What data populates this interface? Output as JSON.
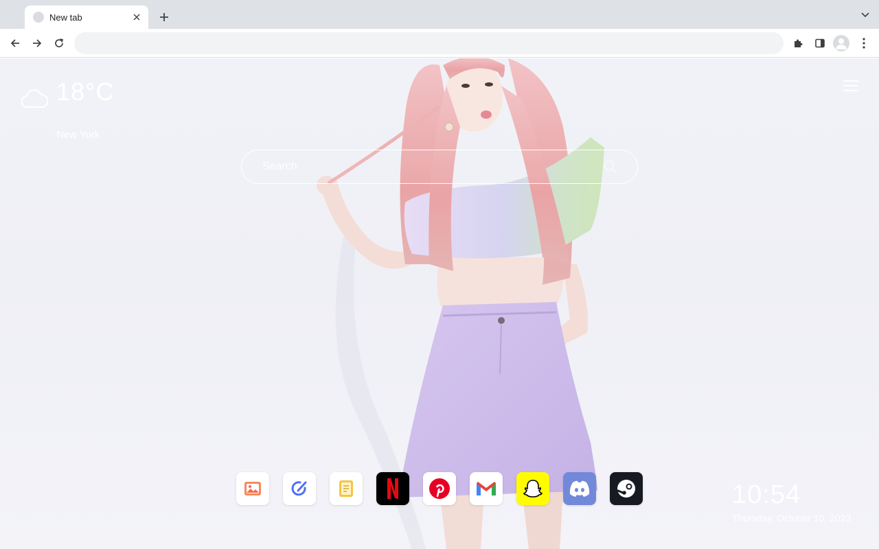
{
  "browser": {
    "tab": {
      "title": "New tab"
    },
    "address_bar": {
      "value": "",
      "placeholder": ""
    }
  },
  "weather": {
    "temperature": "18°C",
    "city": "New York",
    "icon": "cloud-icon"
  },
  "search": {
    "placeholder": "Search"
  },
  "dock": {
    "items": [
      {
        "name": "photos",
        "icon": "image-icon",
        "bg": "#ffffff",
        "accent": "#f26a4b"
      },
      {
        "name": "todo",
        "icon": "check-edit-icon",
        "bg": "#ffffff",
        "accent": "#4f6ef7"
      },
      {
        "name": "notes",
        "icon": "notes-icon",
        "bg": "#ffffff",
        "accent": "#f6c445"
      },
      {
        "name": "netflix",
        "icon": "netflix-icon",
        "bg": "#000000",
        "accent": "#e50914"
      },
      {
        "name": "pinterest",
        "icon": "pinterest-icon",
        "bg": "#ffffff",
        "accent": "#e60023"
      },
      {
        "name": "gmail",
        "icon": "gmail-icon",
        "bg": "#ffffff",
        "accent": "#ea4335"
      },
      {
        "name": "snapchat",
        "icon": "snapchat-icon",
        "bg": "#fffc00",
        "accent": "#000000"
      },
      {
        "name": "discord",
        "icon": "discord-icon",
        "bg": "#7289da",
        "accent": "#ffffff"
      },
      {
        "name": "steam",
        "icon": "steam-icon",
        "bg": "#171a21",
        "accent": "#ffffff"
      }
    ]
  },
  "clock": {
    "time": "10:54",
    "date": "Thursday, October 10, 2023"
  }
}
